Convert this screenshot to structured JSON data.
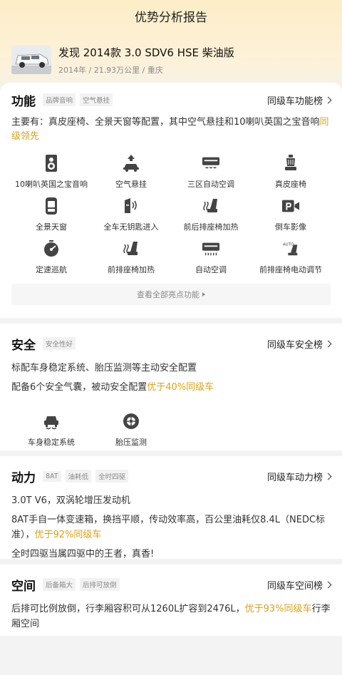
{
  "header": {
    "title": "优势分析报告"
  },
  "car": {
    "name": "发现 2014款 3.0 SDV6 HSE 柴油版",
    "meta": "2014年 / 21.93万公里 / 重庆"
  },
  "features": {
    "title": "功能",
    "tags": [
      "品牌音响",
      "空气悬挂"
    ],
    "link": "同级车功能榜",
    "summary_prefix": "主要有：真皮座椅、全景天窗等配置，其中空气悬挂和10喇叭英国之宝音响",
    "summary_highlight": "同级领先",
    "items": [
      {
        "label": "10喇叭英国之宝音响",
        "icon": "speaker-icon"
      },
      {
        "label": "空气悬挂",
        "icon": "air-suspension-icon"
      },
      {
        "label": "三区自动空调",
        "icon": "climate-control-icon"
      },
      {
        "label": "真皮座椅",
        "icon": "leather-seat-icon"
      },
      {
        "label": "全景天窗",
        "icon": "panoramic-roof-icon"
      },
      {
        "label": "全车无钥匙进入",
        "icon": "keyless-entry-icon"
      },
      {
        "label": "前后排座椅加热",
        "icon": "seat-heating-icon"
      },
      {
        "label": "倒车影像",
        "icon": "reverse-camera-icon"
      },
      {
        "label": "定速巡航",
        "icon": "cruise-control-icon"
      },
      {
        "label": "前排座椅加热",
        "icon": "front-seat-heating-icon"
      },
      {
        "label": "自动空调",
        "icon": "auto-ac-icon"
      },
      {
        "label": "前排座椅电动调节",
        "icon": "power-seat-icon"
      }
    ],
    "view_all": "查看全部亮点功能"
  },
  "safety": {
    "title": "安全",
    "tags": [
      "安全性好"
    ],
    "link": "同级车安全榜",
    "line1": "标配车身稳定系统、胎压监测等主动安全配置",
    "line2_prefix": "配备6个安全气囊，被动安全配置",
    "line2_highlight": "优于40%同级车",
    "items": [
      {
        "label": "车身稳定系统",
        "icon": "stability-control-icon"
      },
      {
        "label": "胎压监测",
        "icon": "tire-pressure-icon"
      }
    ]
  },
  "power": {
    "title": "动力",
    "tags": [
      "8AT",
      "油耗低",
      "全时四驱"
    ],
    "link": "同级车动力榜",
    "line1": "3.0T V6，双涡轮增压发动机",
    "line2_prefix": "8AT手自一体变速箱，换挡平顺，传动效率高，百公里油耗仅8.4L（NEDC标准），",
    "line2_highlight": "优于92%同级车",
    "line3": "全时四驱当属四驱中的王者，真香!"
  },
  "space": {
    "title": "空间",
    "tags": [
      "后备箱大",
      "后排可放倒"
    ],
    "link": "同级车空间榜",
    "line_prefix": "后排可比例放倒，行李厢容积可从1260L扩容到2476L，",
    "line_highlight": "优于93%同级车",
    "line_suffix": "行李厢空间"
  },
  "colors": {
    "accent": "#d8a21c",
    "header_bg": "#fdeec8"
  }
}
